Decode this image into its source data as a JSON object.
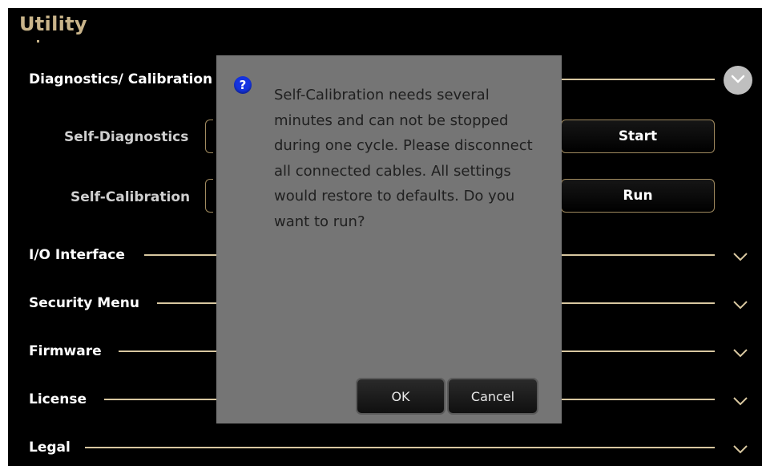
{
  "app": {
    "title": "Utility"
  },
  "sections": [
    {
      "label": "Diagnostics/ Calibration",
      "expanded": true
    },
    {
      "label": "I/O Interface",
      "expanded": false
    },
    {
      "label": "Security Menu",
      "expanded": false
    },
    {
      "label": "Firmware",
      "expanded": false
    },
    {
      "label": "License",
      "expanded": false
    },
    {
      "label": "Legal",
      "expanded": false
    }
  ],
  "diagnostics": {
    "self_diagnostics_label": "Self-Diagnostics",
    "self_diagnostics_button": "Start",
    "self_calibration_label": "Self-Calibration",
    "self_calibration_button": "Run"
  },
  "dialog": {
    "icon": "question-icon",
    "icon_glyph": "?",
    "message": "Self-Calibration needs several minutes and can not be stopped during one cycle. Please disconnect all connected cables. All settings would restore to defaults. Do you want to run?",
    "ok_label": "OK",
    "cancel_label": "Cancel"
  },
  "colors": {
    "background": "#000000",
    "accent": "#c9b48a",
    "rule": "#d8c7a0",
    "dialog": "#757575",
    "question_icon": "#1533e0"
  }
}
